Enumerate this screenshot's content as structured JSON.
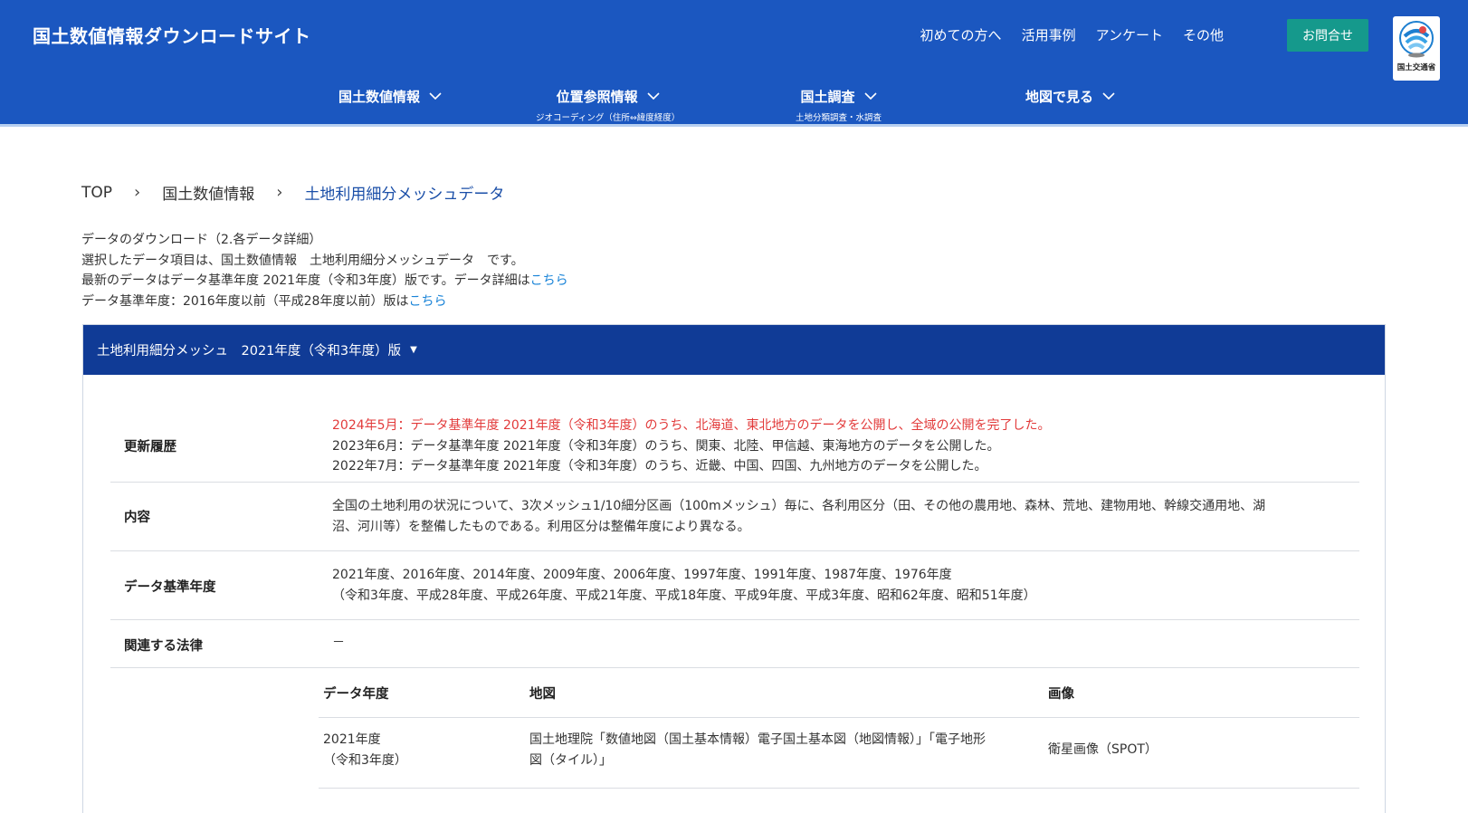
{
  "header": {
    "site_title": "国土数値情報ダウンロードサイト",
    "links": [
      "初めての方へ",
      "活用事例",
      "アンケート",
      "その他"
    ],
    "contact_label": "お問合せ",
    "logo_text": "国土交通省",
    "brand_color": "#1b57c0",
    "accent_color": "#15998c"
  },
  "nav": [
    {
      "label": "国土数値情報",
      "sub": ""
    },
    {
      "label": "位置参照情報",
      "sub": "ジオコーディング（住所⇔緯度経度）"
    },
    {
      "label": "国土調査",
      "sub": "土地分類調査・水調査"
    },
    {
      "label": "地図で見る",
      "sub": ""
    }
  ],
  "breadcrumb": [
    "TOP",
    "国土数値情報",
    "土地利用細分メッシュデータ"
  ],
  "intro": {
    "line1": "データのダウンロード（2.各データ詳細）",
    "line2": "選択したデータ項目は、国土数値情報　土地利用細分メッシュデータ　です。",
    "line3": "最新のデータはデータ基準年度 2021年度（令和3年度）版です。データ詳細は",
    "line3_link": "こちら",
    "line4": "データ基準年度：2016年度以前（平成28年度以前）版は",
    "line4_link": "こちら"
  },
  "panel": {
    "title": "土地利用細分メッシュ　2021年度（令和3年度）版",
    "rows": {
      "history": {
        "label": "更新履歴",
        "items": [
          "2024年5月：データ基準年度 2021年度（令和3年度）のうち、北海道、東北地方のデータを公開し、全域の公開を完了した。",
          "2023年6月：データ基準年度 2021年度（令和3年度）のうち、関東、北陸、甲信越、東海地方のデータを公開した。",
          "2022年7月：データ基準年度 2021年度（令和3年度）のうち、近畿、中国、四国、九州地方のデータを公開した。"
        ]
      },
      "content": {
        "label": "内容",
        "line1": "全国の土地利用の状況について、3次メッシュ1/10細分区画（100mメッシュ）毎に、各利用区分（田、その他の農用地、森林、荒地、建物用地、幹線交通用地、湖",
        "line2": "沼、河川等）を整備したものである。利用区分は整備年度により異なる。"
      },
      "base_year": {
        "label": "データ基準年度",
        "line1": "2021年度、2016年度、2014年度、2009年度、2006年度、1997年度、1991年度、1987年度、1976年度",
        "line2": "（令和3年度、平成28年度、平成26年度、平成21年度、平成18年度、平成9年度、平成3年度、昭和62年度、昭和51年度）"
      },
      "law": {
        "label": "関連する法律",
        "value": "－"
      }
    },
    "source_table": {
      "headers": [
        "データ年度",
        "地図",
        "画像"
      ],
      "rows": [
        {
          "year1": "2021年度",
          "year2": "（令和3年度）",
          "map1": "国土地理院「数値地図（国土基本情報）電子国土基本図（地図情報）」「電子地形",
          "map2": "図（タイル）」",
          "image": "衛星画像（SPOT）"
        }
      ]
    }
  }
}
